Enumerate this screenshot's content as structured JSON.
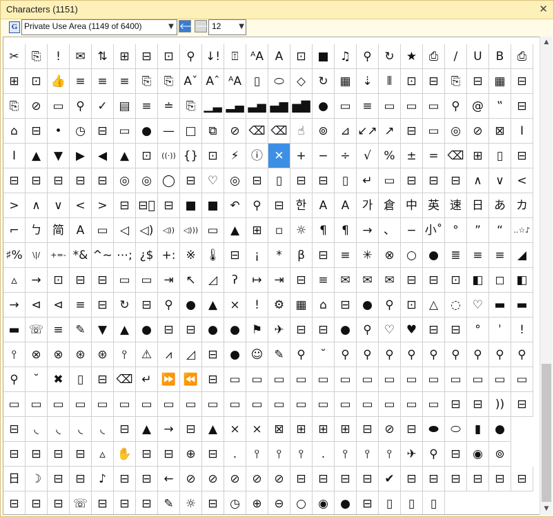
{
  "window": {
    "title": "Characters (1151)",
    "close_glyph": "✕"
  },
  "toolbar": {
    "g_icon": "G",
    "range_select": {
      "value": "Private Use Area (1149 of 6400)"
    },
    "back_glyph": "🡐",
    "forward_glyph": "🡒",
    "font_size": {
      "value": "12"
    }
  },
  "grid": {
    "selected_row": 4,
    "selected_col": 12,
    "rows": [
      [
        "✂",
        "⎘",
        "!",
        "✉",
        "⇅",
        "⊞",
        "⊟",
        "⊡",
        "⚲",
        "↓!",
        "⍐",
        "ᴬA",
        "A",
        "⊡",
        "■",
        "♫",
        "⚲",
        "↻",
        "★",
        "⎙",
        "/",
        "U",
        "B",
        "⎙"
      ],
      [
        "⊞",
        "⊡",
        "👍",
        "≡",
        "≡",
        "≡",
        "⎘",
        "⎘",
        "Aˇ",
        "Aˆ",
        "ᴬA",
        "▯",
        "⬭",
        "◇",
        "↻",
        "▦",
        "⇣",
        "⦀",
        "⊡",
        "⊟",
        "⎘",
        "⊟",
        "▦",
        "⊟"
      ],
      [
        "⎘",
        "⊘",
        "▭",
        "⚲",
        "✓",
        "▤",
        "≡",
        "≐",
        "⎘",
        "▁▃",
        "▂▄",
        "▃▅",
        "▄▆",
        "▅▇",
        "●",
        "▭",
        "≡",
        "▭",
        "▭",
        "▭",
        "⚲",
        "@",
        "‟",
        "⊟"
      ],
      [
        "⌂",
        "⊟",
        "•",
        "◷",
        "⊟",
        "▭",
        "●",
        "—",
        "□",
        "⧉",
        "⊘",
        "⌫",
        "⌫",
        "☝",
        "⊚",
        "⊿",
        "↙↗",
        "↗",
        "⊟",
        "▭",
        "◎",
        "⊘",
        "⊠",
        "I"
      ],
      [
        "I",
        "▲",
        "▼",
        "▶",
        "◀",
        "▲",
        "⊡",
        "((·))",
        "{}",
        "⊡",
        "⚡",
        "ⓘ",
        "✕",
        "+",
        "−",
        "÷",
        "√",
        "%",
        "±",
        "=",
        "⌫",
        "⊞",
        "▯",
        "⊟"
      ],
      [
        "⊟",
        "⊟",
        "⊟",
        "⊟",
        "⊟",
        "◎",
        "◎",
        "◯",
        "⊟",
        "♡",
        "◎",
        "⊟",
        "▯",
        "⊟",
        "⊟",
        "▯",
        "↵",
        "▭",
        "⊟",
        "⊟",
        "⊟",
        "∧",
        "∨",
        "<"
      ],
      [
        ">",
        "∧",
        "∨",
        "<",
        ">",
        "⊟",
        "⊟⃪",
        "⊟",
        "■",
        "■",
        "↶",
        "⚲",
        "⊟",
        "한",
        "A",
        "A",
        "가",
        "倉",
        "中",
        "英",
        "速",
        "日",
        "あ",
        "カ"
      ],
      [
        "⌐",
        "ㄅ",
        "简",
        "A",
        "▭",
        "◁",
        "◁)",
        "◁))",
        "◁)))",
        "▭",
        "▲",
        "⊞",
        "▫",
        "☼",
        "¶",
        "¶",
        "→",
        "、",
        "−",
        "小˚",
        "°",
        "”",
        "“",
        "..☆♪"
      ],
      [
        "♯%",
        "\\|/",
        "+=-",
        "*&",
        "^~",
        "⋯;",
        "¿$",
        "+:",
        "※",
        "🌡",
        "⊟",
        "¡",
        "*",
        "β",
        "⊟",
        "≡",
        "✳",
        "⊗",
        "○",
        "●",
        "≣",
        "≡",
        "≡",
        "◢"
      ],
      [
        "▵",
        "→",
        "⊡",
        "⊟",
        "⊟",
        "▭",
        "▭",
        "⇥",
        "↖",
        "◿",
        "ʔ",
        "↦",
        "⇥",
        "⊟",
        "≡",
        "✉",
        "✉",
        "✉",
        "⊟",
        "⊟",
        "⊡",
        "◧",
        "◻",
        "◧"
      ],
      [
        "→",
        "⊲",
        "⊲",
        "≡",
        "⊟",
        "↻",
        "⊟",
        "⚲",
        "●",
        "▲",
        "×",
        "!",
        "⚙",
        "▦",
        "⌂",
        "⊟",
        "●",
        "⚲",
        "⊡",
        "△",
        "◌",
        "♡",
        "▬",
        "▬"
      ],
      [
        "▬",
        "☏",
        "≡",
        "✎",
        "▼",
        "▲",
        "●",
        "⊟",
        "⊟",
        "●",
        "●",
        "⚑",
        "✈",
        "⊟",
        "⊟",
        "●",
        "⚲",
        "♡",
        "♥",
        "⊟",
        "⊟",
        "°",
        "ˈ",
        "!"
      ],
      [
        "⫯",
        "⊗",
        "⊗",
        "⊛",
        "⊛",
        "⫯",
        "⚠",
        "⩘",
        "◿",
        "⊟",
        "●",
        "☺",
        "✎",
        "⚲",
        "˘",
        "⚲",
        "⚲",
        "⚲",
        "⚲",
        "⚲",
        "⚲",
        "⚲",
        "⚲",
        "⚲"
      ],
      [
        "⚲",
        "˘",
        "✖",
        "▯",
        "⊟",
        "⌫",
        "↵",
        "⏩",
        "⏪",
        "⊟",
        "▭",
        "▭",
        "▭",
        "▭",
        "▭",
        "▭",
        "▭",
        "▭",
        "▭",
        "▭",
        "▭",
        "▭",
        "▭",
        "▭"
      ],
      [
        "▭",
        "▭",
        "▭",
        "▭",
        "▭",
        "▭",
        "▭",
        "▭",
        "▭",
        "▭",
        "▭",
        "▭",
        "▭",
        "▭",
        "▭",
        "▭",
        "▭",
        "▭",
        "▭",
        "▭",
        "⊟",
        "⊟",
        "))",
        "⊟"
      ],
      [
        "⊟",
        "◟",
        "◟",
        "◟",
        "◟",
        "⊟",
        "▲",
        "→",
        "⊟",
        "▲",
        "×",
        "×",
        "⊠",
        "⊞",
        "⊞",
        "⊞",
        "⊟",
        "⊘",
        "⊟",
        "⬬",
        "⬭",
        "▮",
        "●"
      ],
      [
        "⊟",
        "⊟",
        "⊟",
        "⊟",
        "▵",
        "✋",
        "⊟",
        "⊟",
        "⊕",
        "⊟",
        ".",
        "⫯",
        "⫯",
        "⫯",
        ".",
        "⫯",
        "⫯",
        "⫯",
        "✈",
        "⚲",
        "⊟",
        "◉",
        "⊚"
      ],
      [
        "日",
        "☽",
        "⊟",
        "⊟",
        "♪",
        "⊟",
        "⊟",
        "←",
        "⊘",
        "⊘",
        "⊘",
        "⊘",
        "⊘",
        "⊟",
        "⊟",
        "⊟",
        "⊟",
        "✔",
        "⊟",
        "⊟",
        "⊟",
        "⊟",
        "⊟",
        "⊟"
      ],
      [
        "⊟",
        "⊟",
        "⊟",
        "☏",
        "⊟",
        "⊟",
        "⊟",
        "✎",
        "☼",
        "⊟",
        "◷",
        "⊕",
        "⊖",
        "○",
        "◉",
        "●",
        "⊟",
        "▯",
        "▯",
        "▯"
      ]
    ]
  }
}
